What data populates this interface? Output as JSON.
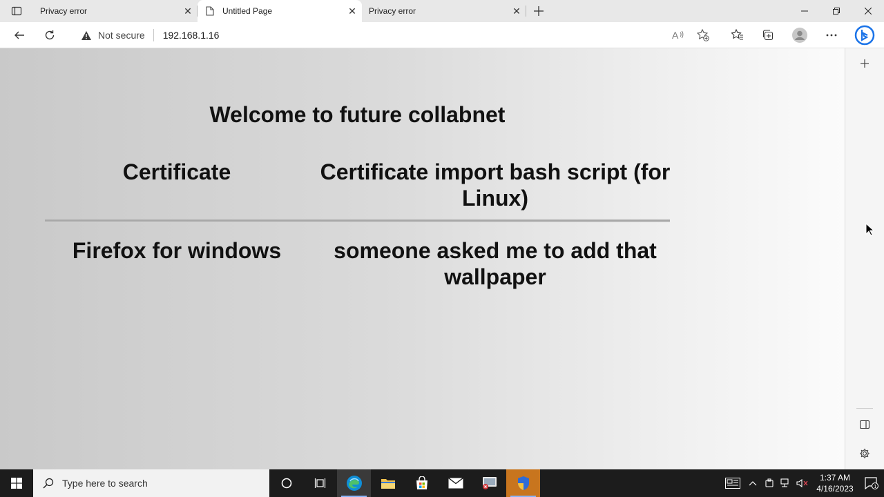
{
  "tabs": [
    {
      "title": "Privacy error",
      "active": false
    },
    {
      "title": "Untitled Page",
      "active": true
    },
    {
      "title": "Privacy error",
      "active": false
    }
  ],
  "address_bar": {
    "security_label": "Not secure",
    "url": "192.168.1.16"
  },
  "page": {
    "title": "Welcome to future collabnet",
    "rows": [
      {
        "left": "Certificate",
        "right": "Certificate import bash script (for Linux)"
      },
      {
        "left": "Firefox for windows",
        "right": "someone asked me to add that wallpaper"
      }
    ]
  },
  "taskbar": {
    "search_placeholder": "Type here to search",
    "time": "1:37 AM",
    "date": "4/16/2023"
  },
  "colors": {
    "edge_blue": "#0f6cbd",
    "taskbar_bg": "#1c1c1c",
    "page_text": "#111111"
  }
}
